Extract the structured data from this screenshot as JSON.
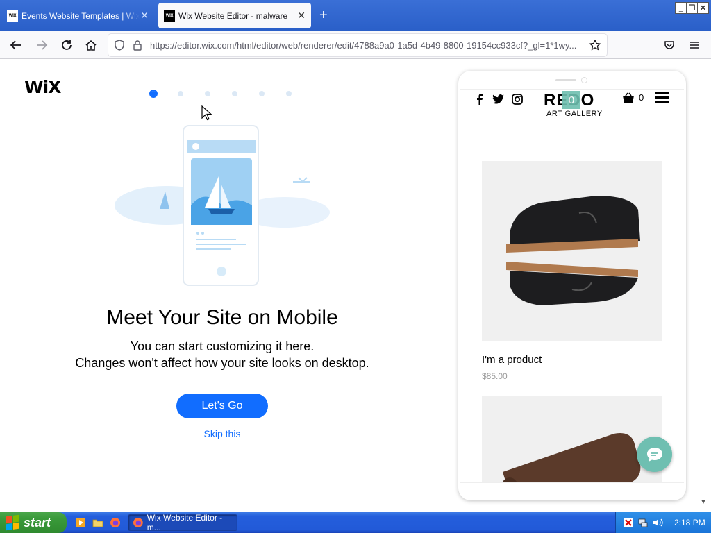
{
  "browser": {
    "tabs": [
      {
        "title": "Events Website Templates | Wix.com",
        "favicon": "WIX",
        "active": false
      },
      {
        "title": "Wix Website Editor - malware",
        "favicon": "WIX",
        "active": true
      }
    ],
    "url": "https://editor.wix.com/html/editor/web/renderer/edit/4788a9a0-1a5d-4b49-8800-19154cc933cf?_gl=1*1wy..."
  },
  "onboarding": {
    "logo": "WiX",
    "steps_total": 6,
    "current_step": 1,
    "heading": "Meet Your Site on Mobile",
    "subtitle_line1": "You can start customizing it here.",
    "subtitle_line2": "Changes won't affect how your site looks on desktop.",
    "primary_button": "Let's Go",
    "skip_link": "Skip this"
  },
  "mobile_preview": {
    "brand": "REDO",
    "brand_badge": "0",
    "brand_subtitle": "ART GALLERY",
    "cart_count": "0",
    "products": [
      {
        "name": "I'm a product",
        "price": "$85.00"
      }
    ],
    "accent_color": "#6fbfb1"
  },
  "taskbar": {
    "start_label": "start",
    "task_item": "Wix Website Editor - m...",
    "clock": "2:18 PM"
  },
  "colors": {
    "primary": "#116dff",
    "taskbar": "#245edc"
  }
}
